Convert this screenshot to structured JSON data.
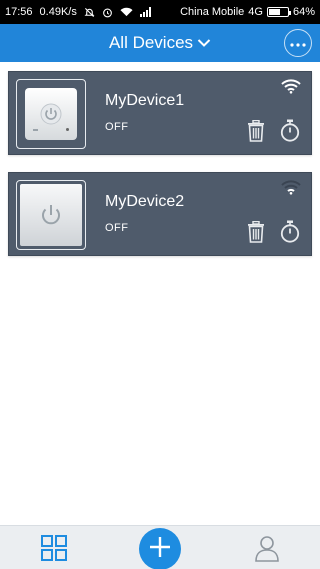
{
  "status_bar": {
    "time": "17:56",
    "speed": "0.49K/s",
    "carrier": "China Mobile",
    "network": "4G",
    "battery_percent": "64%",
    "battery_level": 0.64,
    "icons": [
      "notification-muted-icon",
      "alarm-icon",
      "wifi-icon",
      "signal-icon",
      "battery-icon"
    ]
  },
  "header": {
    "title": "All Devices",
    "title_icon": "chevron-down-icon",
    "more_icon": "more-dots-icon"
  },
  "devices": [
    {
      "name": "MyDevice1",
      "status": "OFF",
      "image": "smart-plug",
      "wifi_signal": "strong"
    },
    {
      "name": "MyDevice2",
      "status": "OFF",
      "image": "power-button",
      "wifi_signal": "weak"
    }
  ],
  "bottom_nav": {
    "items": [
      "grid-icon",
      "add-icon",
      "user-icon"
    ]
  },
  "colors": {
    "primary": "#2185d9",
    "card": "#4f5b6b",
    "bottom_bar": "#ebeef1",
    "fab": "#1e8ce0"
  }
}
